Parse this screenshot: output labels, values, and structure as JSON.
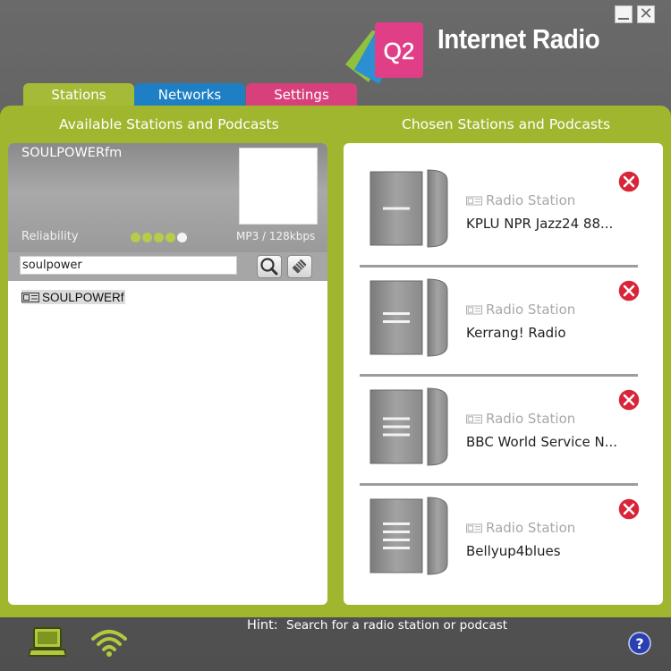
{
  "header": {
    "app_title": "Internet Radio",
    "logo_text": "Q2"
  },
  "window_controls": {
    "close_symbol": "✕"
  },
  "tabs": [
    {
      "label": "Stations",
      "color": "#a5bb38",
      "active": true
    },
    {
      "label": "Networks",
      "color": "#1e7fc5",
      "active": false
    },
    {
      "label": "Settings",
      "color": "#d8407c",
      "active": false
    }
  ],
  "available": {
    "title": "Available Stations and Podcasts",
    "selected_station": "SOULPOWERfm",
    "reliability_label": "Reliability",
    "reliability_rating": 4,
    "reliability_max": 5,
    "format": "MP3 / 128kbps",
    "search_value": "soulpower",
    "results": [
      {
        "name": "SOULPOWERf",
        "icon": "radio-icon"
      }
    ]
  },
  "chosen": {
    "title": "Chosen Stations and Podcasts",
    "items": [
      {
        "type": "Radio Station",
        "name": "KPLU NPR Jazz24 88...",
        "icon_lines": 1
      },
      {
        "type": "Radio Station",
        "name": "Kerrang! Radio",
        "icon_lines": 2
      },
      {
        "type": "Radio Station",
        "name": "BBC World Service N...",
        "icon_lines": 3
      },
      {
        "type": "Radio Station",
        "name": "Bellyup4blues",
        "icon_lines": 4
      }
    ]
  },
  "footer": {
    "hint_label": "Hint:",
    "hint_text": "Search for a radio station or podcast"
  },
  "colors": {
    "accent_green": "#a1b62f",
    "remove_red": "#d8253a",
    "help_blue": "#2a3fb0"
  }
}
